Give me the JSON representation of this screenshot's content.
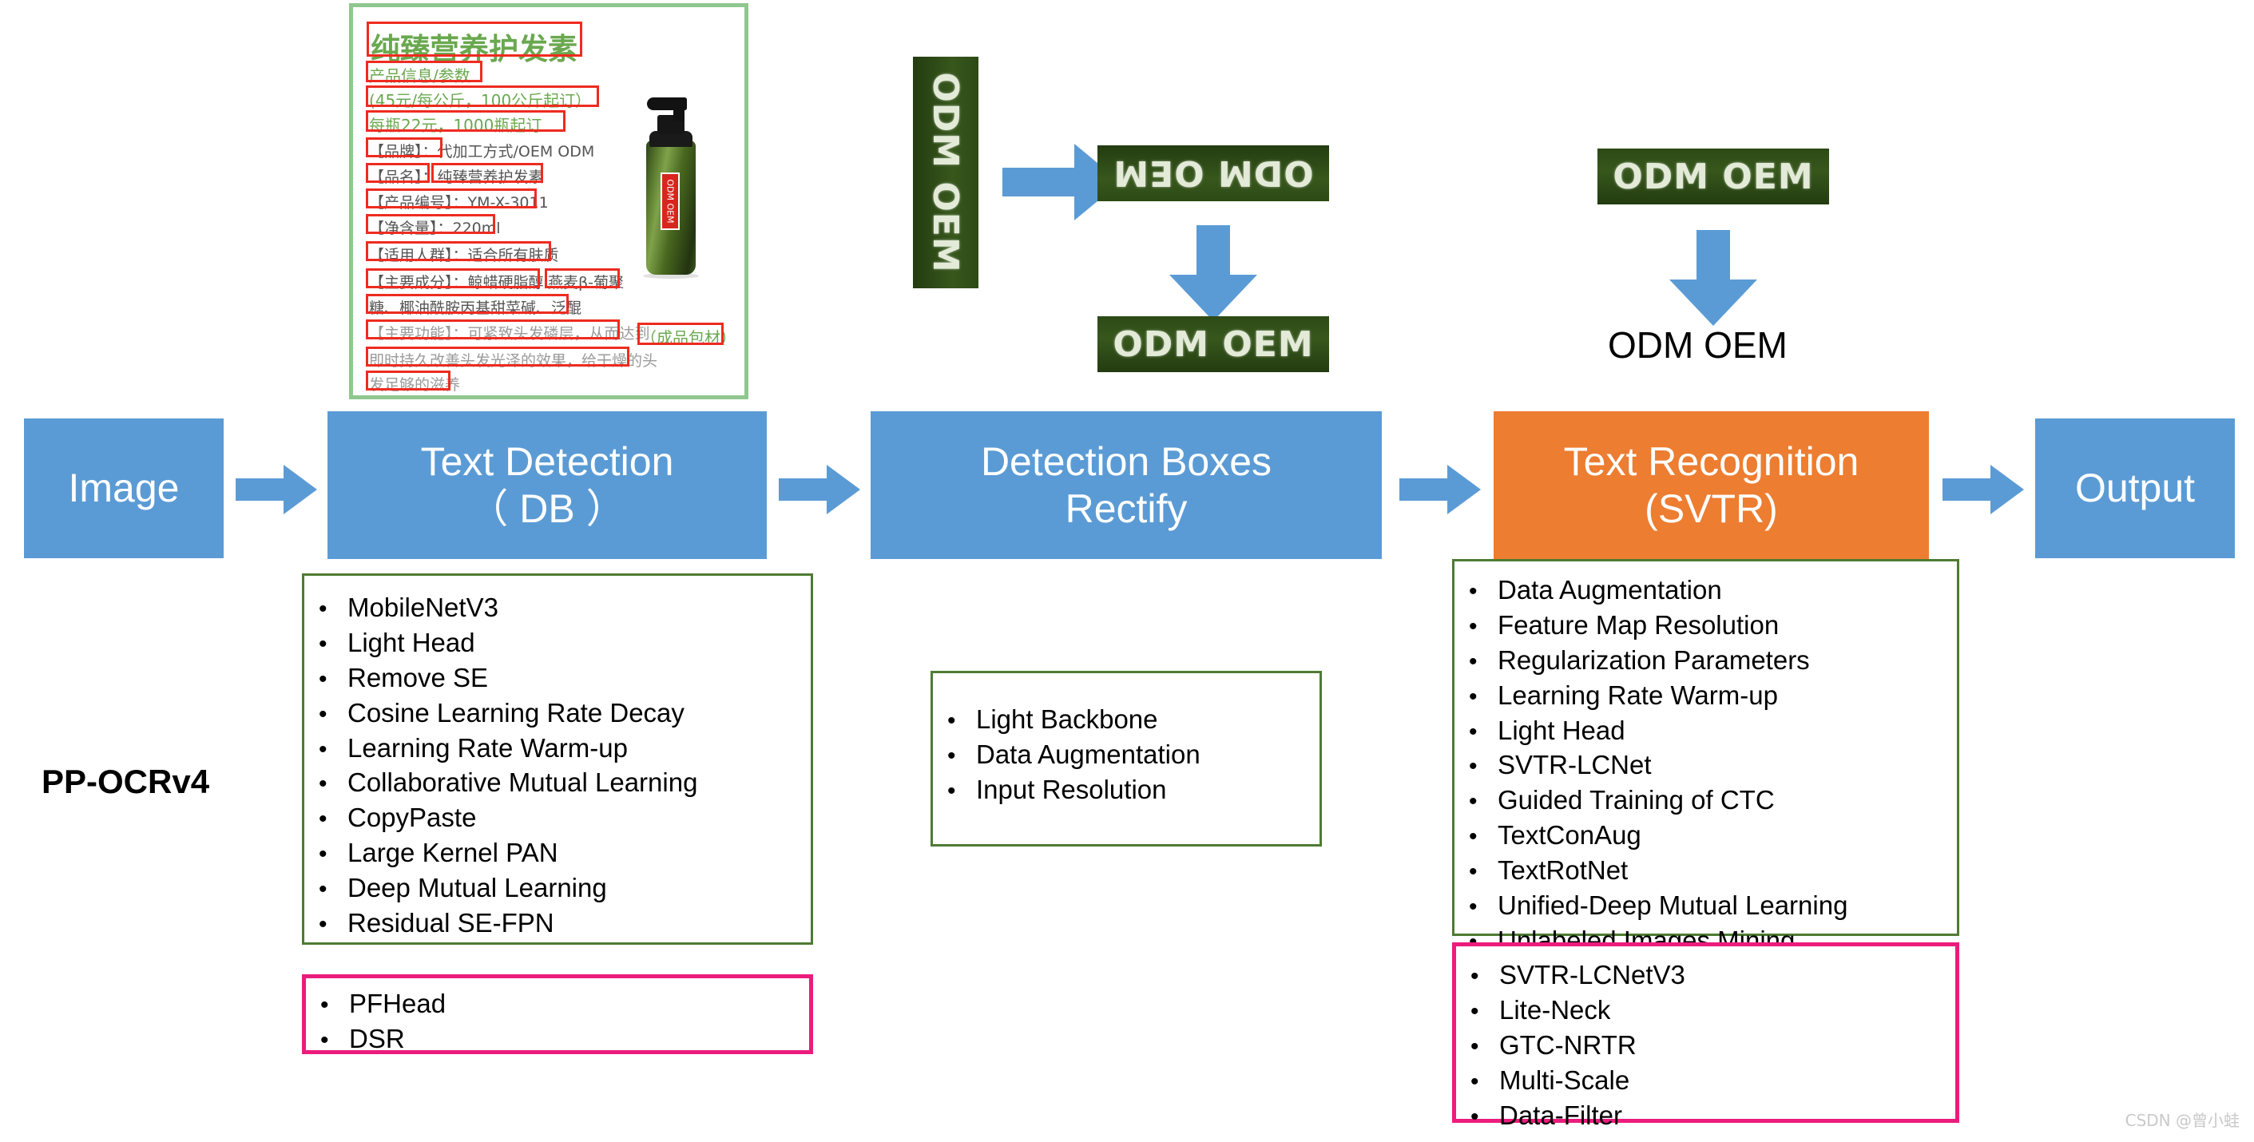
{
  "diagram": {
    "title_label": "PP-OCRv4",
    "watermark": "CSDN @曾小蛙",
    "colors": {
      "blue": "#5B9BD5",
      "orange": "#ED7D31",
      "green_border": "#4E7B33",
      "pink_border": "#EC1C7D",
      "detection_box_red": "#EE2B20",
      "ocr_text_green": "#6AA84F"
    },
    "pipeline": [
      {
        "name": "image",
        "label": "Image",
        "color": "blue"
      },
      {
        "name": "text-detection",
        "label": "Text Detection\n（ DB ）",
        "line1": "Text Detection",
        "line2": "（ DB ）",
        "color": "blue"
      },
      {
        "name": "detection-boxes-rectify",
        "label": "Detection Boxes\nRectify",
        "line1": "Detection Boxes",
        "line2": "Rectify",
        "color": "blue"
      },
      {
        "name": "text-recognition",
        "label": "Text Recognition\n(SVTR)",
        "line1": "Text Recognition",
        "line2": "(SVTR)",
        "color": "orange"
      },
      {
        "name": "output",
        "label": "Output",
        "color": "blue"
      }
    ]
  },
  "product_image": {
    "lines": [
      "纯臻营养护发素",
      "产品信息/参数",
      "(45元/每公斤，100公斤起订）",
      "每瓶22元，1000瓶起订",
      "【品牌】：代加工方式/OEM ODM",
      "【品名】：纯臻营养护发素",
      "【产品编号】：YM-X-3011",
      "【净含量】：220ml",
      "【适用人群】：适合所有肤质",
      "【主要成分】：鲸蜡硬脂醇",
      "燕麦β-葡聚",
      "糖、椰油酰胺丙基甜菜碱、泛醌",
      "【主要功能】：可紧致头发磷层，从而达到",
      "即时持久改善头发光泽的效果，给干燥的头",
      "发足够的滋养"
    ],
    "bottle_label": "ODM OEM",
    "caption": "（成品包材）"
  },
  "crops": {
    "vertical_crop_text": "ODM OEM",
    "rotated_crop_text": "ODM OEM",
    "rectified_crop_text": "ODM OEM",
    "recognition_input_text": "ODM OEM",
    "recognized_text": "ODM OEM"
  },
  "detection_notes": {
    "border": "green",
    "items": [
      "MobileNetV3",
      "Light Head",
      "Remove SE",
      "Cosine Learning Rate Decay",
      "Learning Rate Warm-up",
      "Collaborative Mutual Learning",
      "CopyPaste",
      "Large Kernel PAN",
      "Deep Mutual Learning",
      "Residual SE-FPN"
    ]
  },
  "detection_new_notes": {
    "border": "pink",
    "items": [
      "PFHead",
      "DSR"
    ]
  },
  "rectify_notes": {
    "border": "green",
    "items": [
      "Light Backbone",
      "Data Augmentation",
      "Input Resolution"
    ]
  },
  "recognition_notes": {
    "border": "green",
    "items": [
      "Data Augmentation",
      "Feature Map Resolution",
      "Regularization Parameters",
      "Learning Rate Warm-up",
      "Light Head",
      "SVTR-LCNet",
      "Guided Training of CTC",
      "TextConAug",
      "TextRotNet",
      "Unified-Deep Mutual Learning",
      "Unlabeled Images Mining"
    ]
  },
  "recognition_new_notes": {
    "border": "pink",
    "items": [
      "SVTR-LCNetV3",
      "Lite-Neck",
      "GTC-NRTR",
      "Multi-Scale",
      "Data-Filter"
    ]
  },
  "bullet_char": "•"
}
